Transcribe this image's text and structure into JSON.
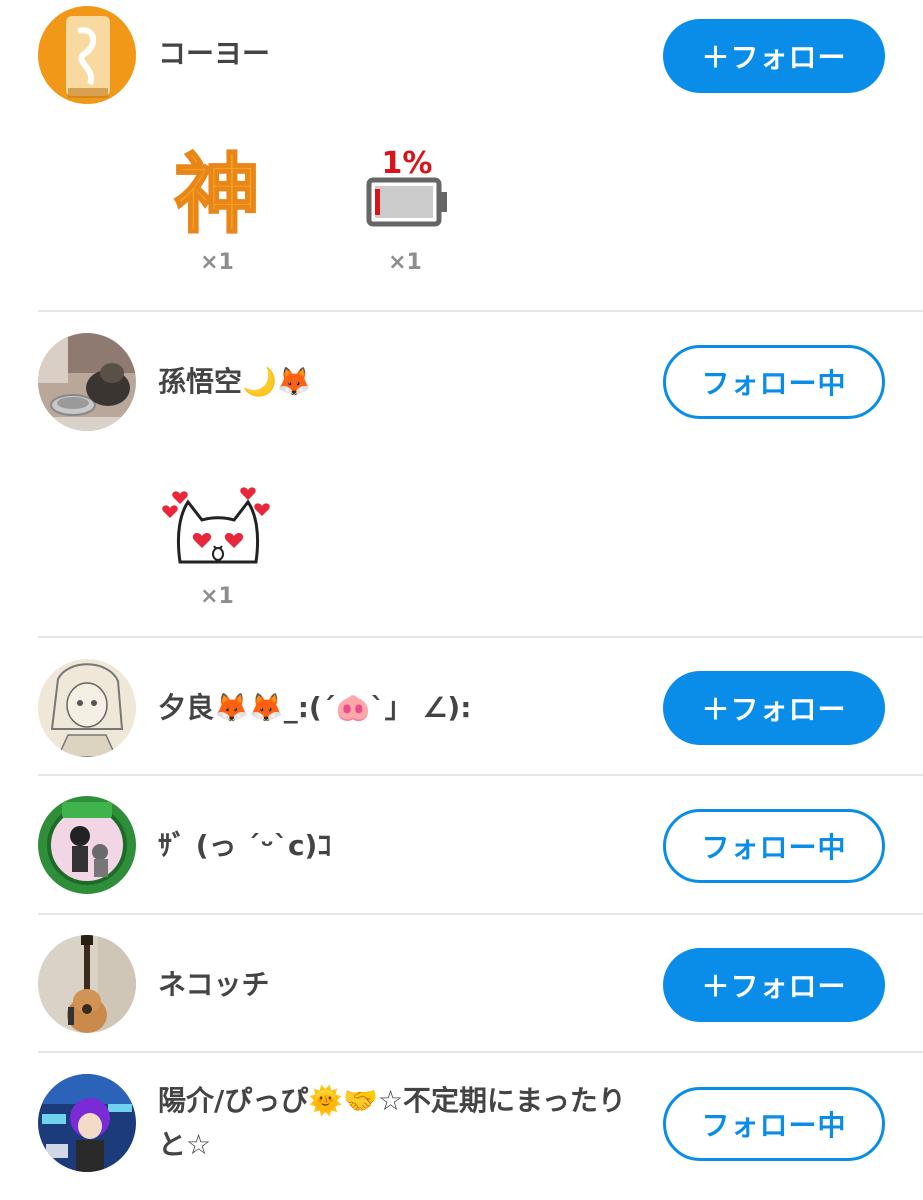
{
  "users": [
    {
      "name": "コーヨー",
      "avatar_icon": "amber-glass-photo-icon",
      "button": "＋フォロー",
      "state": "follow",
      "stickers": [
        {
          "icon": "kami-kanji-sticker-icon",
          "glyph": "神",
          "count": "×1"
        },
        {
          "icon": "low-battery-sticker-icon",
          "label": "1%",
          "count": "×1"
        }
      ]
    },
    {
      "name": "孫悟空🌙🦊",
      "avatar_icon": "cat-with-bowl-photo-icon",
      "button": "フォロー中",
      "state": "following",
      "stickers": [
        {
          "icon": "heart-eyes-cat-sticker-icon",
          "count": "×1"
        }
      ]
    },
    {
      "name": "夕良🦊🦊_:(´🐽`」 ∠):",
      "avatar_icon": "sketch-girl-drawing-icon",
      "button": "＋フォロー",
      "state": "follow"
    },
    {
      "name": "ｻﾞ (っ ˊᵕˋc)ｺ",
      "avatar_icon": "green-badge-anime-icon",
      "button": "フォロー中",
      "state": "following"
    },
    {
      "name": "ネコッチ",
      "avatar_icon": "guitar-photo-icon",
      "button": "＋フォロー",
      "state": "follow"
    },
    {
      "name": "陽介/ぴっぴ🌞🤝☆不定期にまったりと☆",
      "avatar_icon": "purple-hair-anime-icon",
      "button": "フォロー中",
      "state": "following"
    }
  ],
  "colors": {
    "accent": "#0a8de8",
    "divider": "#e6e6e6",
    "count_text": "#8e8e8e",
    "battery_red": "#d8141a",
    "kami_orange": "#f7a21b"
  }
}
